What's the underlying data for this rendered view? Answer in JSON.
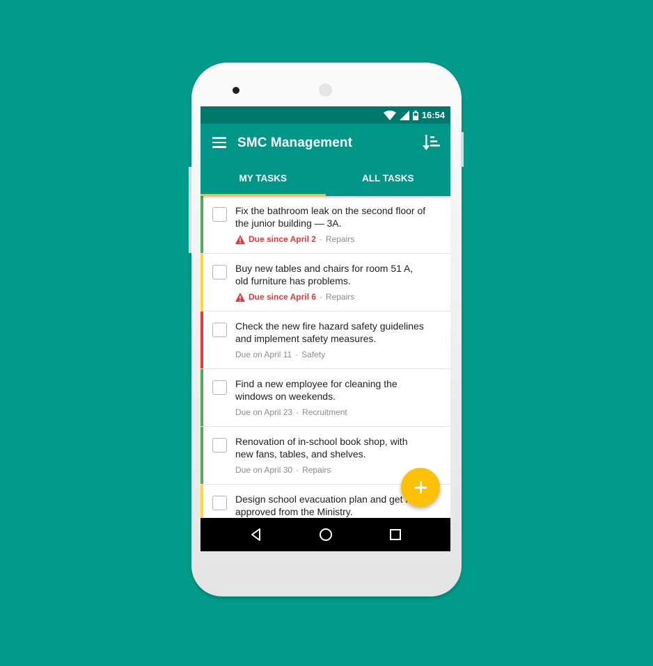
{
  "status_bar": {
    "time": "16:54"
  },
  "app_bar": {
    "title": "SMC Management"
  },
  "tabs": [
    {
      "label": "MY TASKS",
      "active": true
    },
    {
      "label": "ALL TASKS",
      "active": false
    }
  ],
  "tasks": [
    {
      "title": "Fix the bathroom leak on the second floor of\nthe junior building — 3A.",
      "due": "Due since April 2",
      "category": "Repairs",
      "overdue": true,
      "priority_color": "#4caf50"
    },
    {
      "title": "Buy new tables and chairs for room 51 A,\nold furniture has problems.",
      "due": "Due since April 6",
      "category": "Repairs",
      "overdue": true,
      "priority_color": "#fdd835"
    },
    {
      "title": "Check the new fire hazard safety guidelines\nand implement safety measures.",
      "due": "Due on April 11",
      "category": "Safety",
      "overdue": false,
      "priority_color": "#e53935"
    },
    {
      "title": "Find a new employee for cleaning the\nwindows on weekends.",
      "due": "Due on April 23",
      "category": "Recruitment",
      "overdue": false,
      "priority_color": "#4caf50"
    },
    {
      "title": "Renovation of in-school book shop, with\nnew fans, tables, and shelves.",
      "due": "Due on April 30",
      "category": "Repairs",
      "overdue": false,
      "priority_color": "#4caf50"
    },
    {
      "title": "Design school evacuation plan and get it\napproved from the Ministry.",
      "due": "",
      "category": "",
      "overdue": false,
      "priority_color": "#fdd835"
    }
  ],
  "meta_separator": "·",
  "colors": {
    "background": "#009b8a",
    "primary": "#009688",
    "primary_dark": "#00796b",
    "accent": "#ffc107",
    "overdue": "#e53935"
  },
  "icons": [
    "menu-icon",
    "sort-icon",
    "wifi-icon",
    "signal-icon",
    "battery-icon",
    "warning-icon",
    "add-icon",
    "back-icon",
    "home-icon",
    "recents-icon"
  ]
}
